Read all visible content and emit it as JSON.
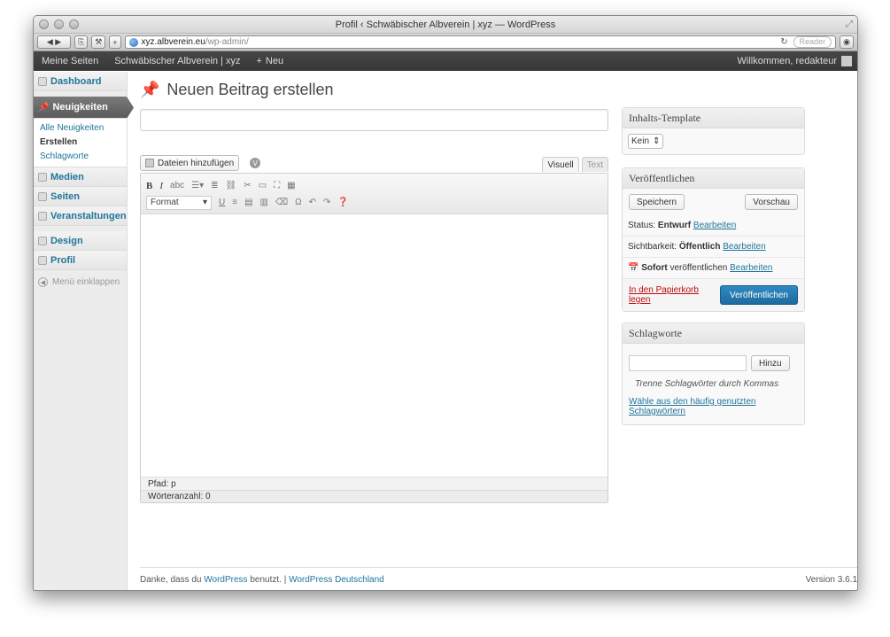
{
  "window": {
    "title": "Profil ‹ Schwäbischer Albverein | xyz — WordPress"
  },
  "browser": {
    "url_host": "xyz.albverein.eu",
    "url_path": "/wp-admin/",
    "reader_label": "Reader"
  },
  "adminbar": {
    "my_sites": "Meine Seiten",
    "site_name": "Schwäbischer Albverein | xyz",
    "new_label": "Neu",
    "welcome": "Willkommen, redakteur"
  },
  "sidebar": {
    "dashboard": "Dashboard",
    "news": "Neuigkeiten",
    "news_sub": [
      "Alle Neuigkeiten",
      "Erstellen",
      "Schlagworte"
    ],
    "media": "Medien",
    "pages": "Seiten",
    "events": "Veranstaltungen",
    "design": "Design",
    "profile": "Profil",
    "collapse": "Menü einklappen"
  },
  "page": {
    "title": "Neuen Beitrag erstellen"
  },
  "editor": {
    "add_media": "Dateien hinzufügen",
    "tab_visual": "Visuell",
    "tab_text": "Text",
    "format_select": "Format",
    "path": "Pfad: p",
    "word_count": "Wörteranzahl: 0"
  },
  "template_box": {
    "title": "Inhalts-Template",
    "select_value": "Kein"
  },
  "publish_box": {
    "title": "Veröffentlichen",
    "save": "Speichern",
    "preview": "Vorschau",
    "status_label": "Status:",
    "status_value": "Entwurf",
    "visibility_label": "Sichtbarkeit:",
    "visibility_value": "Öffentlich",
    "schedule_value": "Sofort",
    "schedule_label": "veröffentlichen",
    "edit": "Bearbeiten",
    "trash": "In den Papierkorb legen",
    "publish": "Veröffentlichen"
  },
  "tags_box": {
    "title": "Schlagworte",
    "add": "Hinzu",
    "hint": "Trenne Schlagwörter durch Kommas",
    "choose": "Wähle aus den häufig genutzten Schlagwörtern"
  },
  "footer": {
    "thanks_pre": "Danke, dass du",
    "wordpress": "WordPress",
    "thanks_post": "benutzt. |",
    "wp_de": "WordPress Deutschland",
    "version": "Version 3.6.1"
  },
  "colors": {
    "link": "#21759b",
    "publish_button": "#2481b8",
    "trash": "#bc0b0b"
  }
}
